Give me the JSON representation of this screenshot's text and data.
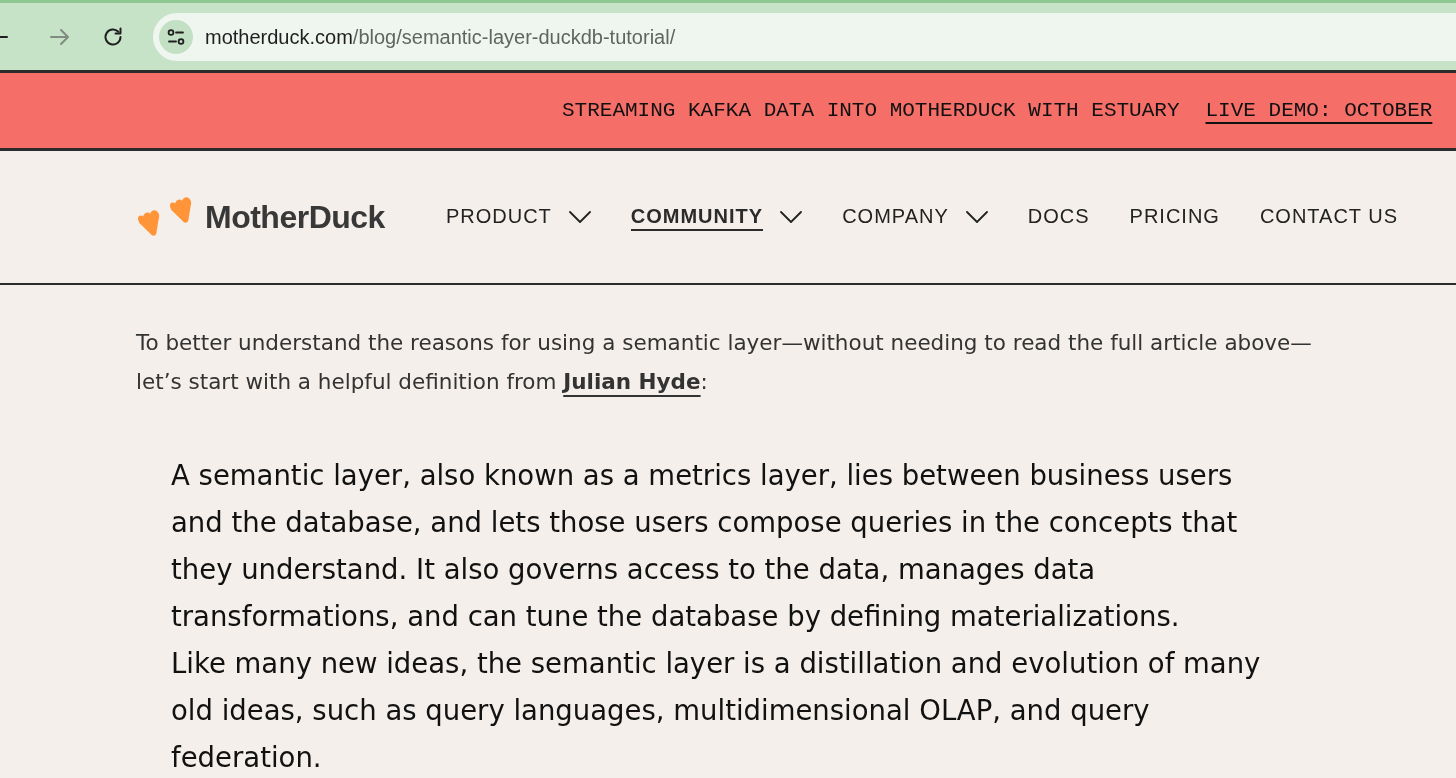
{
  "browser": {
    "nav_buttons": [
      {
        "kind": "back",
        "disabled": false
      },
      {
        "kind": "forward",
        "disabled": true
      },
      {
        "kind": "reload",
        "disabled": false
      }
    ],
    "address": {
      "domain": "motherduck.com",
      "path": "/blog/semantic-layer-duckdb-tutorial/"
    }
  },
  "banner": {
    "text": "STREAMING KAFKA DATA INTO MOTHERDUCK WITH ESTUARY",
    "link": "LIVE DEMO: OCTOBER"
  },
  "header": {
    "logo": {
      "text": "MotherDuck"
    },
    "nav": [
      {
        "label": "PRODUCT",
        "kind": "dropdown",
        "selected": false
      },
      {
        "label": "COMMUNITY",
        "kind": "dropdown",
        "selected": true
      },
      {
        "label": "COMPANY",
        "kind": "dropdown",
        "selected": false
      },
      {
        "label": "DOCS",
        "kind": "link",
        "selected": false
      },
      {
        "label": "PRICING",
        "kind": "link",
        "selected": false
      },
      {
        "label": "CONTACT US",
        "kind": "link",
        "selected": false
      }
    ]
  },
  "article": {
    "intro": {
      "before": "To better understand the reasons for using a semantic layer—without needing to read the full article above—let’s start with a helpful definition from ",
      "link": "Julian Hyde",
      "after": ":"
    },
    "quote": [
      "A semantic layer, also known as a metrics layer, lies between business users and the database, and lets those users compose queries in the concepts that they understand. It also governs access to the data, manages data transformations, and can tune the database by defining materializations.",
      "Like many new ideas, the semantic layer is a distillation and evolution of many old ideas, such as query languages, multidimensional OLAP, and query federation."
    ]
  }
}
